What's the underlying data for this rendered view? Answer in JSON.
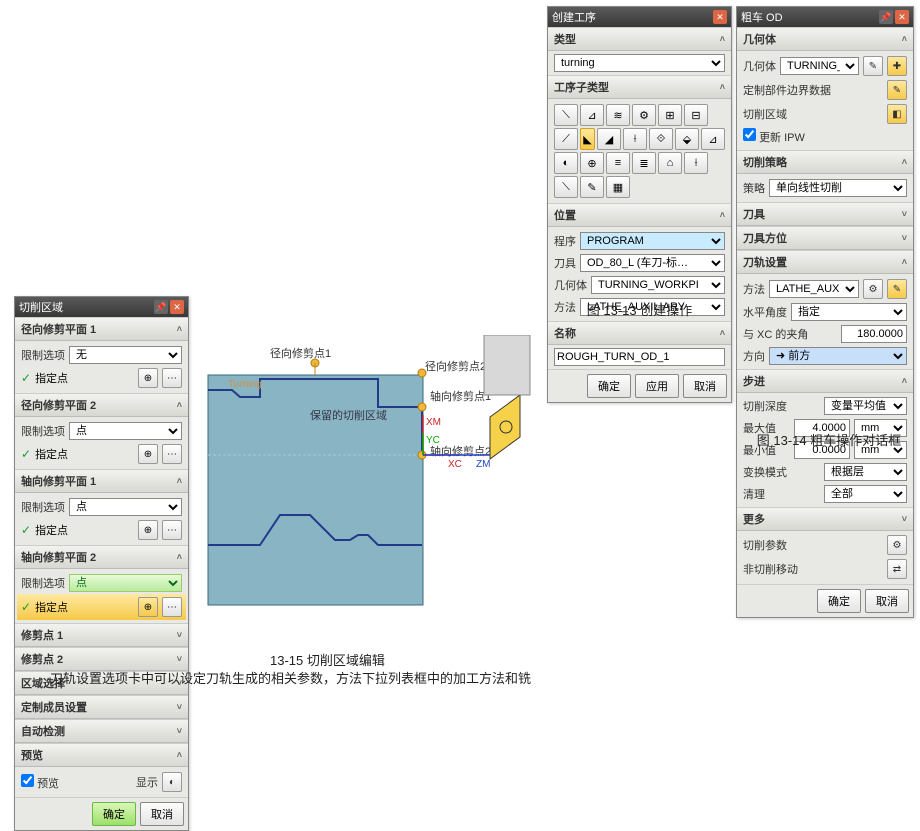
{
  "cutregion": {
    "title": "切削区域",
    "sections": {
      "rad1": "径向修剪平面 1",
      "rad2": "径向修剪平面 2",
      "ax1": "轴向修剪平面 1",
      "ax2": "轴向修剪平面 2",
      "trim1": "修剪点 1",
      "trim2": "修剪点 2",
      "regsel": "区域选择",
      "custom": "定制成员设置",
      "autodet": "自动检测",
      "preview": "预览"
    },
    "limit_opt_label": "限制选项",
    "limit_opt_value_none": "无",
    "limit_opt_value_point": "点",
    "specify_point": "指定点",
    "preview_chk": "预览",
    "display_btn": "显示",
    "ok": "确定",
    "cancel": "取消"
  },
  "createop": {
    "title": "创建工序",
    "sections": {
      "type": "类型",
      "subtype": "工序子类型",
      "location": "位置",
      "name": "名称"
    },
    "type_value": "turning",
    "loc_program_label": "程序",
    "loc_program_value": "PROGRAM",
    "loc_tool_label": "刀具",
    "loc_tool_value": "OD_80_L (车刀-标…",
    "loc_geom_label": "几何体",
    "loc_geom_value": "TURNING_WORKPI",
    "loc_method_label": "方法",
    "loc_method_value": "LATHE_AUXILIARY",
    "name_value": "ROUGH_TURN_OD_1",
    "ok": "确定",
    "apply": "应用",
    "cancel": "取消"
  },
  "roughod": {
    "title": "粗车 OD",
    "sections": {
      "geom": "几何体",
      "strat": "切削策略",
      "tool": "刀具",
      "toolaxis": "刀具方位",
      "pathset": "刀轨设置",
      "more": "更多",
      "cutparams": "切削参数",
      "noncut": "非切削移动"
    },
    "geom_label": "几何体",
    "geom_value": "TURNING_WO…",
    "custom_bound": "定制部件边界数据",
    "cut_region": "切削区域",
    "update_ipw_label": "更新 IPW",
    "strat_label": "策略",
    "strat_value": "单向线性切削",
    "method_label": "方法",
    "method_value": "LATHE_AUXILI",
    "horiz_label": "水平角度",
    "horiz_value": "指定",
    "angle_label": "与 XC 的夹角",
    "angle_value": "180.0000",
    "dir_label": "方向",
    "dir_value": "➜ 前方",
    "step_label": "步进",
    "cutdepth_label": "切削深度",
    "cutdepth_value": "变量平均值",
    "max_label": "最大值",
    "max_value": "4.0000",
    "min_label": "最小值",
    "min_value": "0.0000",
    "unit": "mm",
    "chg_mode_label": "变换模式",
    "chg_mode_value": "根据层",
    "clean_label": "清理",
    "clean_value": "全部",
    "ok": "确定",
    "cancel": "取消"
  },
  "captions": {
    "c1": "图 13-13  创建操作",
    "c2": "图 13-14  粗车操作对话框",
    "c3": "13-15  切削区域编辑",
    "c4": "刀轨设置选项卡中可以设定刀轨生成的相关参数，方法下拉列表框中的加工方法和铣"
  },
  "diagram": {
    "radial1": "径向修剪点1",
    "radial2": "径向修剪点2",
    "axial1": "轴向修剪点1",
    "axial2": "轴向修剪点2",
    "keep_region": "保留的切削区域",
    "turning": "Turning",
    "xm": "XM",
    "yc": "YC",
    "xc": "XC",
    "zm": "ZM"
  }
}
